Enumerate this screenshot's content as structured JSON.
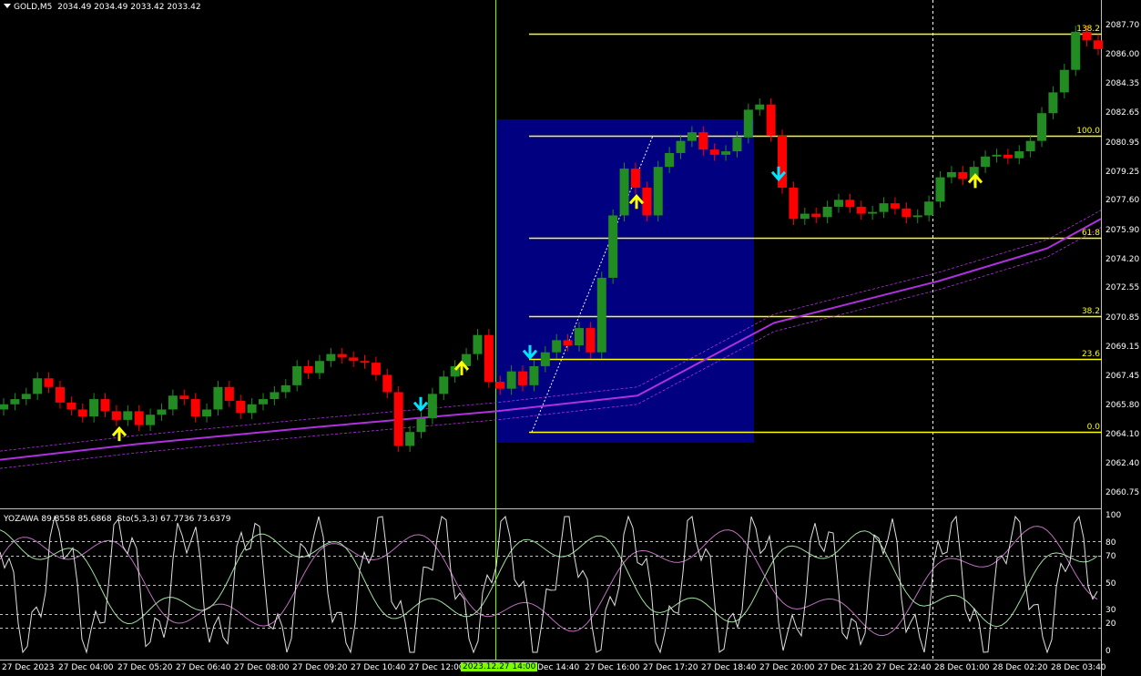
{
  "header": {
    "symbol": "GOLD,M5",
    "ohlc": "2034.49 2034.49 2033.42 2033.42"
  },
  "indicator_header": {
    "name": "YOZAWA 89.8558 85.6868",
    "stochastic": "Sto(5,3,3) 67.7736 73.6379"
  },
  "price_axis": [
    "2087.70",
    "2086.00",
    "2084.35",
    "2082.65",
    "2080.95",
    "2079.25",
    "2077.60",
    "2075.90",
    "2074.20",
    "2072.55",
    "2070.85",
    "2069.15",
    "2067.45",
    "2065.80",
    "2064.10",
    "2062.40",
    "2060.75"
  ],
  "osc_axis": [
    "100",
    "80",
    "70",
    "50",
    "30",
    "20",
    "0"
  ],
  "fib_levels": [
    {
      "label": "138.2",
      "price": 2087.3
    },
    {
      "label": "100.0",
      "price": 2081.4
    },
    {
      "label": "61.8",
      "price": 2075.5
    },
    {
      "label": "38.2",
      "price": 2071.0
    },
    {
      "label": "23.6",
      "price": 2068.5
    },
    {
      "label": "0.0",
      "price": 2064.3
    }
  ],
  "time_axis": [
    "27 Dec 2023",
    "27 Dec 04:00",
    "27 Dec 05:20",
    "27 Dec 06:40",
    "27 Dec 08:00",
    "27 Dec 09:20",
    "27 Dec 10:40",
    "27 Dec 12:00",
    "Dec 14:40",
    "27 Dec 16:00",
    "27 Dec 17:20",
    "27 Dec 18:40",
    "27 Dec 20:00",
    "27 Dec 21:20",
    "27 Dec 22:40",
    "28 Dec 01:00",
    "28 Dec 02:20",
    "28 Dec 03:40"
  ],
  "time_highlight": "2023.12.27 14:00",
  "colors": {
    "bull": "#228b22",
    "bear": "#ff0000",
    "ma": "#b030e0",
    "fib": "#ffff00",
    "box": "#000080",
    "vline": "#7cfc00",
    "arrow_up": "#ffff00",
    "arrow_down": "#00e5ff",
    "stoch_main": "#e0e0e0",
    "stoch_signal": "#c070c0",
    "stoch_fast": "#a0e0a0"
  },
  "chart_data": {
    "type": "candlestick",
    "symbol": "GOLD",
    "timeframe": "M5",
    "ylim": [
      2060.0,
      2088.6
    ],
    "close_series": [
      2065.9,
      2066.2,
      2066.5,
      2067.4,
      2066.9,
      2066.0,
      2065.6,
      2065.2,
      2066.2,
      2065.5,
      2065.0,
      2065.5,
      2064.7,
      2065.3,
      2065.6,
      2066.4,
      2066.2,
      2065.2,
      2065.6,
      2066.9,
      2066.1,
      2065.4,
      2065.9,
      2066.2,
      2066.6,
      2067.0,
      2068.1,
      2067.7,
      2068.4,
      2068.8,
      2068.6,
      2068.4,
      2068.3,
      2067.6,
      2066.6,
      2063.5,
      2064.3,
      2065.1,
      2066.5,
      2067.5,
      2068.1,
      2068.8,
      2069.9,
      2067.2,
      2066.8,
      2067.8,
      2067.0,
      2068.1,
      2068.9,
      2069.6,
      2069.3,
      2070.3,
      2068.9,
      2073.2,
      2076.8,
      2079.5,
      2078.4,
      2076.8,
      2079.6,
      2080.4,
      2081.1,
      2081.6,
      2080.6,
      2080.3,
      2080.5,
      2081.3,
      2082.9,
      2083.2,
      2081.4,
      2078.4,
      2076.6,
      2076.9,
      2076.7,
      2077.3,
      2077.7,
      2077.3,
      2076.9,
      2077.0,
      2077.5,
      2077.2,
      2076.7,
      2076.8,
      2077.6,
      2079.0,
      2079.3,
      2078.9,
      2079.6,
      2080.2,
      2080.3,
      2080.1,
      2080.5,
      2081.1,
      2082.7,
      2083.9,
      2085.2,
      2087.4,
      2086.9,
      2086.4
    ]
  }
}
